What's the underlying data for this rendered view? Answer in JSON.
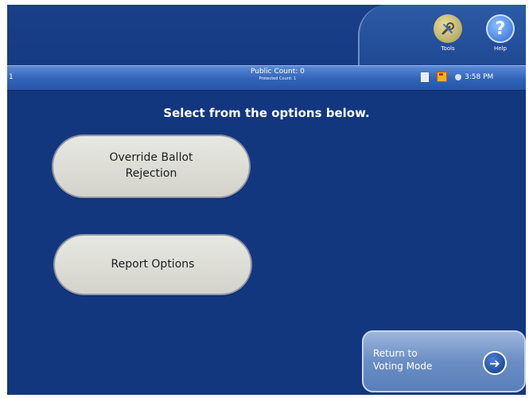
{
  "toolbar": {
    "tools_label": "Tools",
    "help_label": "Help",
    "help_glyph": "?",
    "tools_icon": "tools-icon",
    "help_icon": "help-icon"
  },
  "status_bar": {
    "left_text": "1",
    "public_count": "Public Count: 0",
    "protected_count": "Protected Count: 1",
    "time": "3:58 PM"
  },
  "main": {
    "instruction": "Select from the options below.",
    "options": [
      {
        "label": "Override Ballot Rejection"
      },
      {
        "label": "Report Options"
      }
    ]
  },
  "footer": {
    "return_label_line1": "Return to",
    "return_label_line2": "Voting Mode",
    "return_icon": "arrow-right-icon"
  },
  "colors": {
    "background": "#13377f",
    "status_bar": "#3163b8",
    "button_face": "#dcdcd6"
  }
}
